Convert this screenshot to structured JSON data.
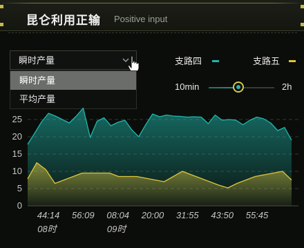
{
  "header": {
    "title": "昆仑利用正输",
    "subtitle": "Positive input"
  },
  "dropdown": {
    "selected": "瞬时产量",
    "options": [
      "瞬时产量",
      "平均产量"
    ],
    "highlighted_index": 0
  },
  "legend": [
    {
      "label": "支路四",
      "color": "#1fb8ad"
    },
    {
      "label": "支路五",
      "color": "#e0c63a"
    }
  ],
  "slider": {
    "min_label": "10min",
    "max_label": "2h",
    "value_fraction": 0.42
  },
  "colors": {
    "accent": "#c9b94a",
    "teal": "#1fb8ad",
    "yellow": "#e0c63a"
  },
  "chart_data": {
    "type": "area",
    "ylim": [
      0,
      30
    ],
    "yticks": [
      0,
      5,
      10,
      15,
      20,
      25
    ],
    "x_tick_labels": [
      {
        "time": "44:14",
        "hour": "08时"
      },
      {
        "time": "56:09",
        "hour": ""
      },
      {
        "time": "08:04",
        "hour": "09时"
      },
      {
        "time": "20:00",
        "hour": ""
      },
      {
        "time": "31:55",
        "hour": ""
      },
      {
        "time": "43:50",
        "hour": ""
      },
      {
        "time": "55:45",
        "hour": ""
      }
    ],
    "series": [
      {
        "name": "支路四",
        "color": "#1fb8ad",
        "values": [
          17.8,
          21,
          24.3,
          26.8,
          26,
          25,
          24,
          26,
          28.3,
          19.8,
          24.5,
          25.5,
          23.2,
          24.2,
          24.8,
          22,
          20,
          23.5,
          26.6,
          25.8,
          26.3,
          26,
          25.9,
          25.7,
          25.8,
          25.7,
          23.8,
          26.3,
          24.8,
          25,
          24.8,
          23.5,
          24.8,
          25.7,
          25.2,
          24,
          21.8,
          22.7,
          19
        ]
      },
      {
        "name": "支路五",
        "color": "#e0c63a",
        "values": [
          7.8,
          12.5,
          10.5,
          6.5,
          7.5,
          8.5,
          9.5,
          9.5,
          9.5,
          9.5,
          8.5,
          8.5,
          8.5,
          8,
          7.5,
          7,
          8.5,
          10,
          9,
          8,
          7,
          6,
          5.2,
          6.5,
          7.5,
          8.5,
          9,
          9.5,
          10,
          7.5
        ]
      }
    ]
  }
}
